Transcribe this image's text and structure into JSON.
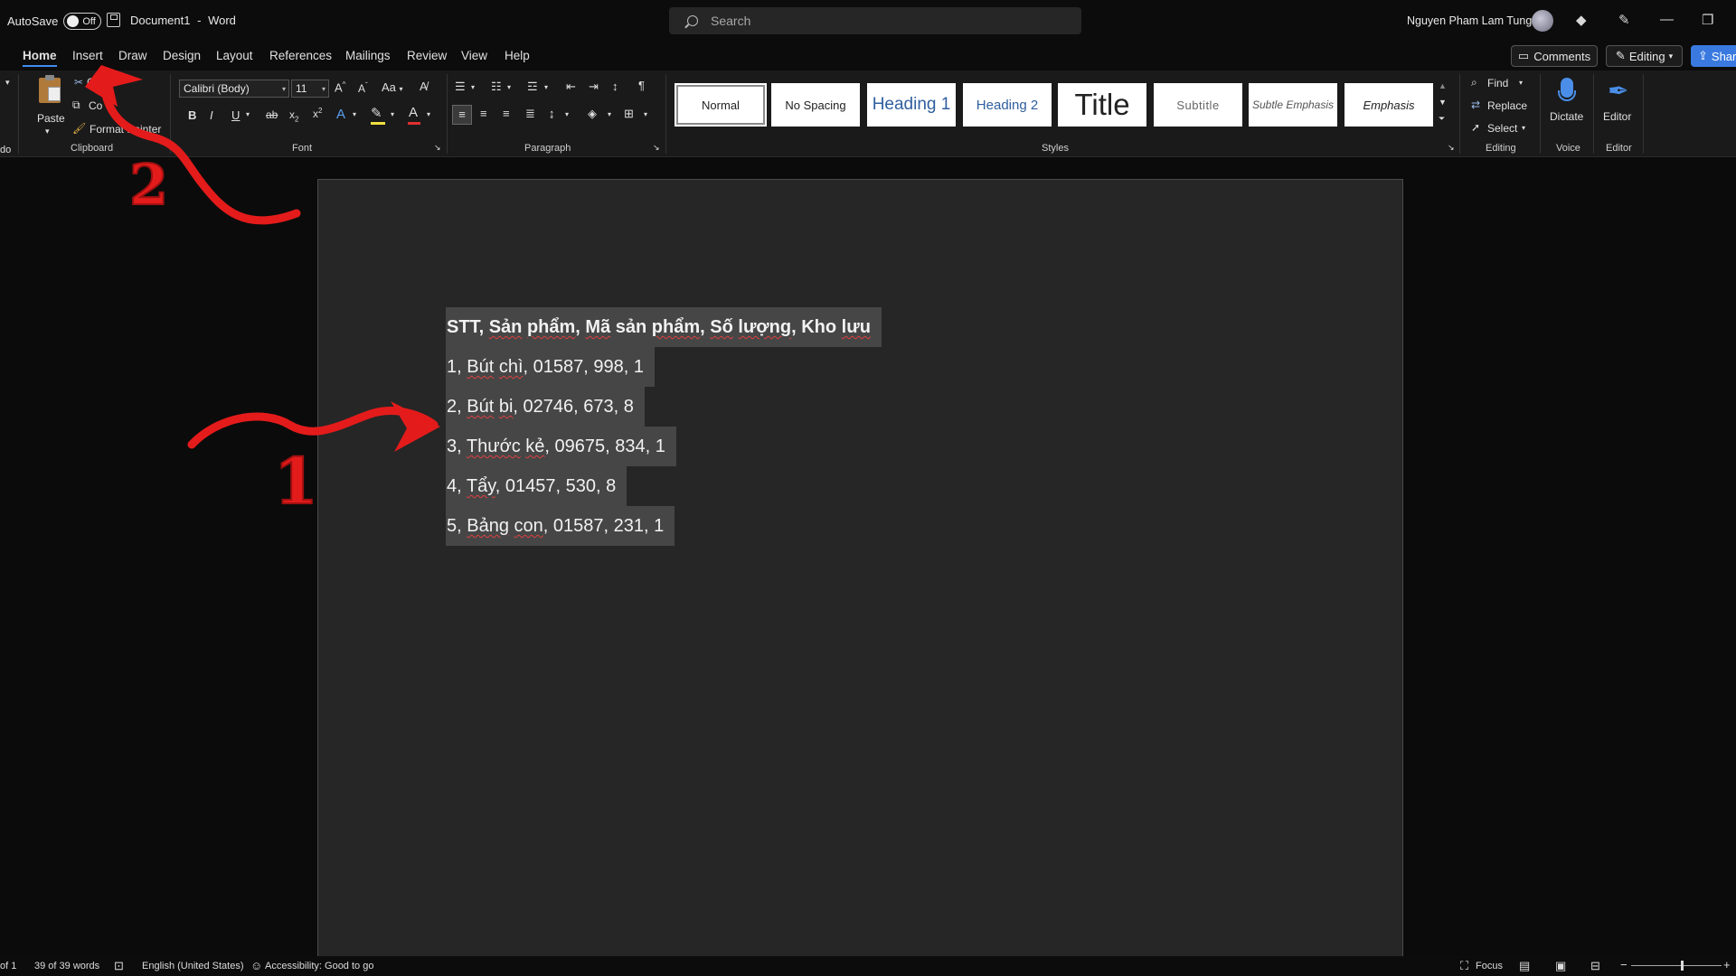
{
  "titlebar": {
    "autosave_label": "AutoSave",
    "autosave_state": "Off",
    "doc_title": "Document1",
    "app_sep": "-",
    "app_name": "Word",
    "search_placeholder": "Search",
    "user_name": "Nguyen Pham Lam Tung"
  },
  "menu": {
    "tabs": [
      "Home",
      "Insert",
      "Draw",
      "Design",
      "Layout",
      "References",
      "Mailings",
      "Review",
      "View",
      "Help"
    ],
    "active_tab": "Home",
    "comments_label": "Comments",
    "editing_label": "Editing",
    "share_label": "Shar"
  },
  "ribbon": {
    "undo_label": "do",
    "clipboard": {
      "paste_label": "Paste",
      "cut_label": "Cut",
      "copy_label": "Co",
      "format_painter_label": "Format Painter",
      "group_label": "Clipboard"
    },
    "font": {
      "font_name": "Calibri (Body)",
      "font_size": "11",
      "change_case_label": "Aa",
      "group_label": "Font",
      "highlight_color": "#f0e040",
      "font_color": "#e03030"
    },
    "paragraph": {
      "group_label": "Paragraph"
    },
    "styles": {
      "items": [
        "Normal",
        "No Spacing",
        "Heading 1",
        "Heading 2",
        "Title",
        "Subtitle",
        "Subtle Emphasis",
        "Emphasis"
      ],
      "selected": "Normal",
      "group_label": "Styles"
    },
    "editing": {
      "find_label": "Find",
      "replace_label": "Replace",
      "select_label": "Select",
      "group_label": "Editing"
    },
    "voice": {
      "dictate_label": "Dictate",
      "group_label": "Voice"
    },
    "editor": {
      "editor_label": "Editor",
      "group_label": "Editor"
    }
  },
  "document": {
    "lines": [
      "STT, Sản phẩm, Mã sản phẩm, Số lượng, Kho lưu",
      "1, Bút chì, 01587, 998, 1",
      "2, Bút bi, 02746, 673, 8",
      "3, Thước kẻ, 09675, 834, 1",
      "4, Tẩy, 01457, 530, 8",
      "5, Bảng con, 01587, 231, 1"
    ]
  },
  "statusbar": {
    "page_info": "of 1",
    "word_count": "39 of 39 words",
    "language": "English (United States)",
    "accessibility": "Accessibility: Good to go",
    "focus_label": "Focus",
    "zoom_minus": "−",
    "zoom_plus": "+"
  },
  "annotations": {
    "label_1": "1",
    "label_2": "2",
    "color": "#e41b1b"
  }
}
